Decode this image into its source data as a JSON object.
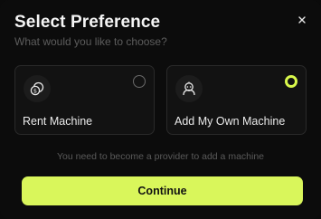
{
  "modal": {
    "title": "Select Preference",
    "subtitle": "What would you like to choose?"
  },
  "options": [
    {
      "label": "Rent Machine",
      "icon": "coins-icon",
      "selected": false
    },
    {
      "label": "Add My Own Machine",
      "icon": "robot-icon",
      "selected": true
    }
  ],
  "notice": "You need to become a provider to add a machine",
  "continue_label": "Continue",
  "colors": {
    "accent": "#d9f65b",
    "background": "#0c0c0c",
    "card": "#121212"
  }
}
